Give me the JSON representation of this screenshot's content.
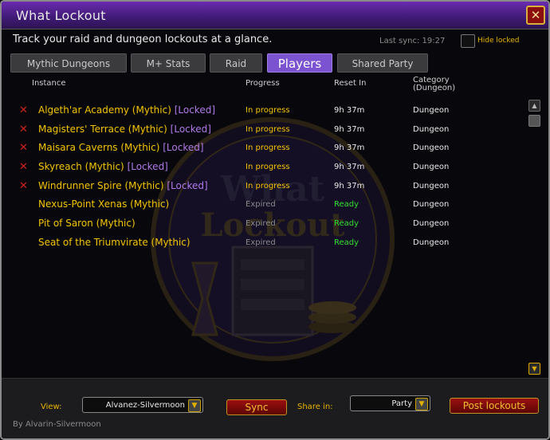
{
  "window": {
    "title": "What Lockout",
    "close_label": "✕"
  },
  "subtitle": "Track your raid and dungeon lockouts at a glance.",
  "last_sync": "Last sync: 19:27",
  "hide_locked": {
    "label": "Hide locked",
    "checked": false
  },
  "tabs": [
    {
      "label": "Mythic Dungeons",
      "active": false
    },
    {
      "label": "M+ Stats",
      "active": false
    },
    {
      "label": "Raid",
      "active": false
    },
    {
      "label": "Players",
      "active": true
    },
    {
      "label": "Shared Party",
      "active": false
    }
  ],
  "columns": {
    "instance": "Instance",
    "progress": "Progress",
    "reset_in": "Reset In",
    "category": "Category\n(Dungeon)"
  },
  "rows": [
    {
      "mark": "✕",
      "name": "Algeth'ar Academy (Mythic)",
      "locked": "[Locked]",
      "progress": "In progress",
      "reset": "9h 37m",
      "category": "Dungeon"
    },
    {
      "mark": "✕",
      "name": "Magisters' Terrace (Mythic)",
      "locked": "[Locked]",
      "progress": "In progress",
      "reset": "9h 37m",
      "category": "Dungeon"
    },
    {
      "mark": "✕",
      "name": "Maisara Caverns (Mythic)",
      "locked": "[Locked]",
      "progress": "In progress",
      "reset": "9h 37m",
      "category": "Dungeon"
    },
    {
      "mark": "✕",
      "name": "Skyreach (Mythic)",
      "locked": "[Locked]",
      "progress": "In progress",
      "reset": "9h 37m",
      "category": "Dungeon"
    },
    {
      "mark": "✕",
      "name": "Windrunner Spire (Mythic)",
      "locked": "[Locked]",
      "progress": "In progress",
      "reset": "9h 37m",
      "category": "Dungeon"
    },
    {
      "mark": "",
      "name": "Nexus-Point Xenas (Mythic)",
      "locked": "",
      "progress": "Expired",
      "reset": "Ready",
      "category": "Dungeon"
    },
    {
      "mark": "",
      "name": "Pit of Saron (Mythic)",
      "locked": "",
      "progress": "Expired",
      "reset": "Ready",
      "category": "Dungeon"
    },
    {
      "mark": "",
      "name": "Seat of the Triumvirate (Mythic)",
      "locked": "",
      "progress": "Expired",
      "reset": "Ready",
      "category": "Dungeon"
    }
  ],
  "emblem": {
    "line1": "What",
    "line2": "Lockout"
  },
  "bottom": {
    "view_label": "View:",
    "view_value": "Alvanez-Silvermoon",
    "sync_label": "Sync",
    "share_label": "Share in:",
    "share_value": "Party",
    "post_label": "Post lockouts",
    "byline": "By Alvarin-Silvermoon"
  },
  "colors": {
    "title_purple": "#6a2bb0",
    "instance_gold": "#f4c400",
    "locked_purple": "#b07ae8",
    "in_progress_gold": "#f4c400",
    "expired_gray": "#8b8b8b",
    "ready_green": "#33dd33",
    "reset_white": "#e8e8e8",
    "x_red": "#d02020"
  },
  "icons": {
    "close": "close-icon",
    "mark": "red-x-icon",
    "dropdown": "chevron-down-icon",
    "scroll_up": "arrow-up-icon",
    "scroll_down": "arrow-down-icon"
  }
}
